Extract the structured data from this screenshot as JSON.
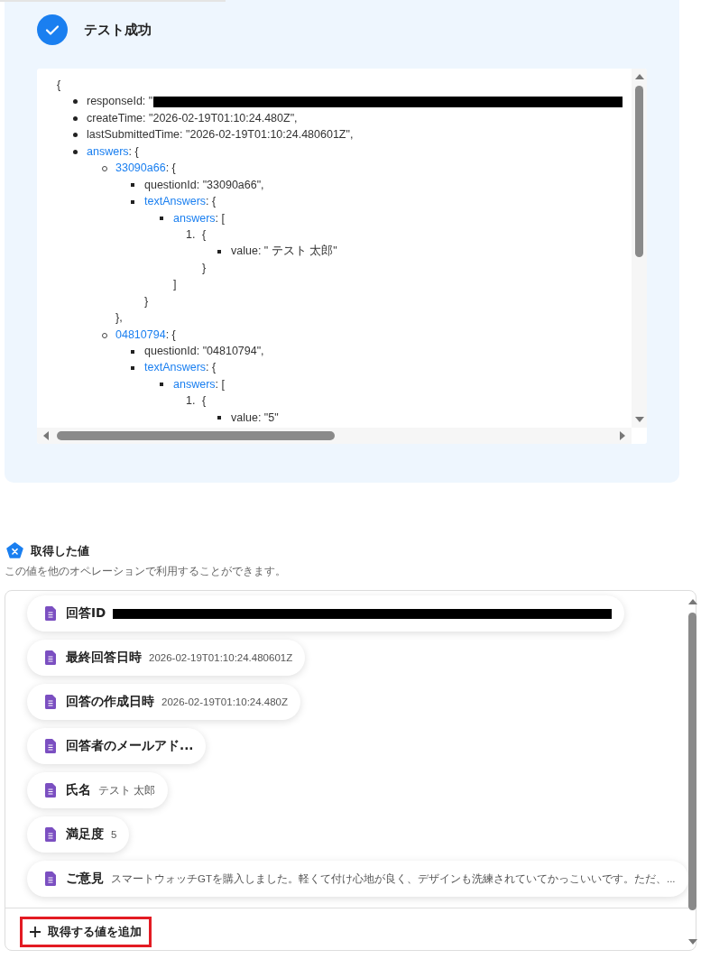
{
  "test_result": {
    "title": "テスト成功"
  },
  "json_view": {
    "open": "{",
    "items": [
      {
        "key": "responseId",
        "suffix": ": \"",
        "redacted": true
      },
      {
        "key": "createTime",
        "suffix": ": \"2026-02-19T01:10:24.480Z\","
      },
      {
        "key": "lastSubmittedTime",
        "suffix": ": \"2026-02-19T01:10:24.480601Z\","
      },
      {
        "key": "answers",
        "link": true,
        "suffix": ": {",
        "children": [
          {
            "key": "33090a66",
            "link": true,
            "suffix": ": {",
            "close": "},",
            "children": [
              {
                "key": "questionId",
                "suffix": ": \"33090a66\","
              },
              {
                "key": "textAnswers",
                "link": true,
                "suffix": ": {",
                "close": "}",
                "children": [
                  {
                    "key": "answers",
                    "link": true,
                    "suffix": ": [",
                    "close": "]",
                    "children": [
                      {
                        "marker": "1.",
                        "suffix": "{",
                        "close": "}",
                        "children": [
                          {
                            "key": "value",
                            "suffix": ": \" テスト 太郎\""
                          }
                        ]
                      }
                    ]
                  }
                ]
              }
            ]
          },
          {
            "key": "04810794",
            "link": true,
            "suffix": ": {",
            "children": [
              {
                "key": "questionId",
                "suffix": ": \"04810794\","
              },
              {
                "key": "textAnswers",
                "link": true,
                "suffix": ": {",
                "children": [
                  {
                    "key": "answers",
                    "link": true,
                    "suffix": ": [",
                    "children": [
                      {
                        "marker": "1.",
                        "suffix": "{",
                        "children": [
                          {
                            "key": "value",
                            "suffix": ": \"5\""
                          }
                        ]
                      }
                    ]
                  }
                ]
              }
            ]
          }
        ]
      }
    ]
  },
  "values_section": {
    "title": "取得した値",
    "description": "この値を他のオペレーションで利用することができます。",
    "values": [
      {
        "label": "回答ID",
        "redacted": true
      },
      {
        "label": "最終回答日時",
        "value": "2026-02-19T01:10:24.480601Z"
      },
      {
        "label": "回答の作成日時",
        "value": "2026-02-19T01:10:24.480Z"
      },
      {
        "label": "回答者のメールアド..."
      },
      {
        "label": "氏名",
        "value": "テスト 太郎"
      },
      {
        "label": "満足度",
        "value": "5"
      },
      {
        "label": "ご意見",
        "value": "スマートウォッチGTを購入しました。軽くて付け心地が良く、デザインも洗練されていてかっこいいです。ただ、..."
      }
    ],
    "add_button": "取得する値を追加"
  }
}
